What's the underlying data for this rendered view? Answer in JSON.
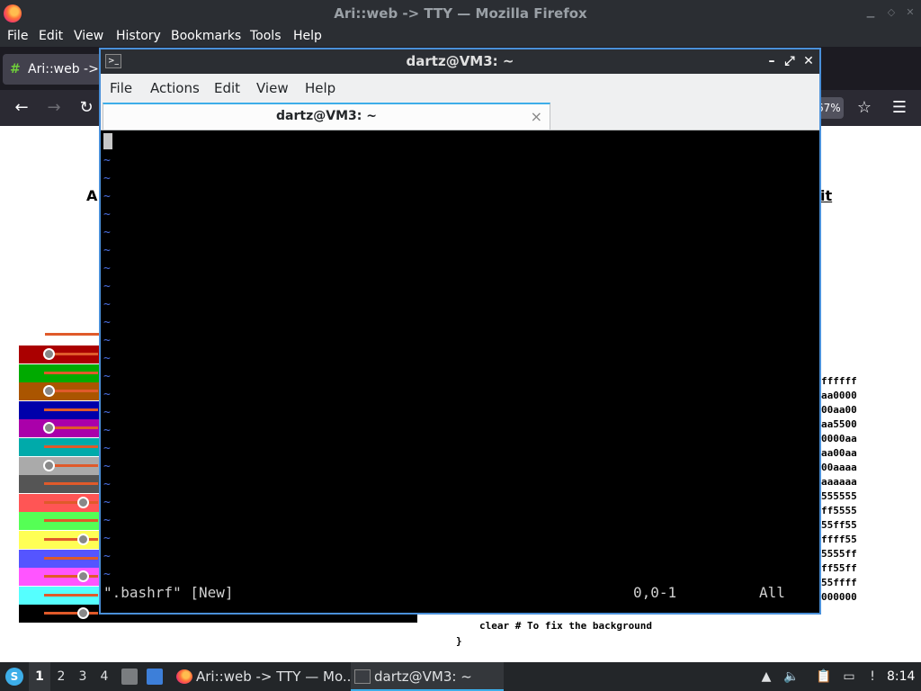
{
  "firefox": {
    "window_title": "Ari::web -> TTY — Mozilla Firefox",
    "menu": [
      "File",
      "Edit",
      "View",
      "History",
      "Bookmarks",
      "Tools",
      "Help"
    ],
    "tab_label": "Ari::web ->",
    "zoom_text": "67%"
  },
  "webpage": {
    "heading_left": "A",
    "heading_right": "it",
    "swatch_colors": [
      "#aa0000",
      "#00aa00",
      "#aa5500",
      "#0000aa",
      "#aa00aa",
      "#00aaaa",
      "#aaaaaa",
      "#555555",
      "#ff5555",
      "#55ff55",
      "#ffff55",
      "#5555ff",
      "#ff55ff",
      "#55ffff",
      "#000000"
    ],
    "hex_fragments": [
      "ffffff",
      "aa0000",
      "00aa00",
      "aa5500",
      "0000aa",
      "aa00aa",
      "00aaaa",
      "aaaaaa",
      "555555",
      "ff5555",
      "55ff55",
      "ffff55",
      "5555ff",
      "ff55ff",
      "55ffff",
      "000000"
    ],
    "code_line_1": "clear # To fix the background",
    "code_line_2": "}"
  },
  "terminal": {
    "window_title": "dartz@VM3: ~",
    "menu": [
      "File",
      "Actions",
      "Edit",
      "View",
      "Help"
    ],
    "tab_label": "dartz@VM3: ~",
    "tab_close": "×",
    "status_file": "\".bashrf\" [New]",
    "status_pos": "0,0-1",
    "status_scroll": "All"
  },
  "taskbar": {
    "workspaces": [
      "1",
      "2",
      "3",
      "4"
    ],
    "task_firefox": "Ari::web -> TTY — Mo...",
    "task_terminal": "dartz@VM3: ~",
    "clock": "8:14"
  }
}
